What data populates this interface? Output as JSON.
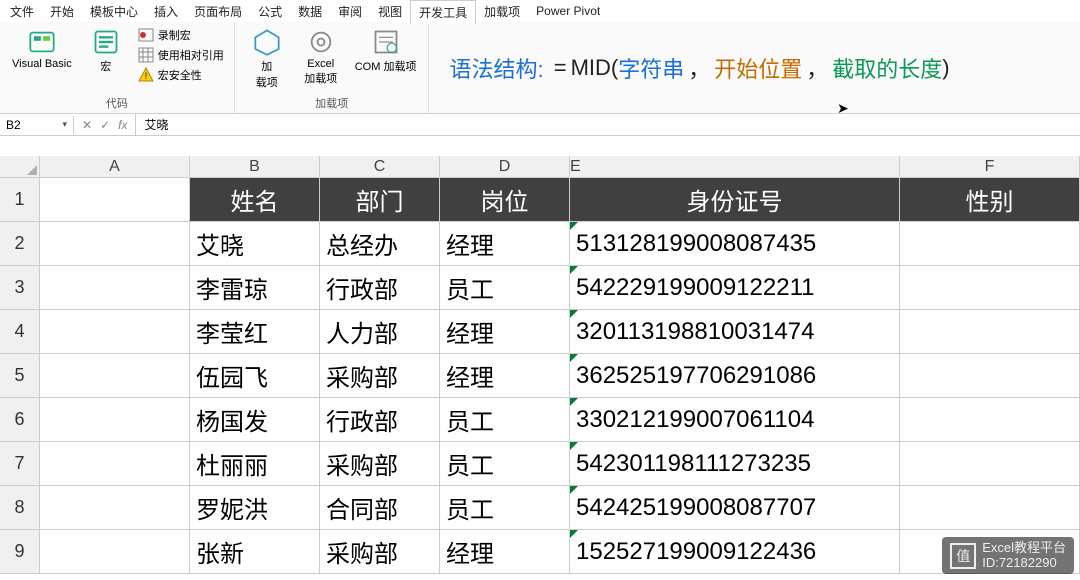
{
  "menu": {
    "items": [
      "文件",
      "开始",
      "模板中心",
      "插入",
      "页面布局",
      "公式",
      "数据",
      "审阅",
      "视图",
      "开发工具",
      "加载项",
      "Power Pivot"
    ],
    "active_index": 9
  },
  "ribbon": {
    "group1": {
      "label": "代码",
      "vb": "Visual Basic",
      "macro": "宏",
      "record": "录制宏",
      "relative": "使用相对引用",
      "security": "宏安全性"
    },
    "group2": {
      "label": "加载项",
      "addins": "加\n载项",
      "excel_addins": "Excel\n加载项",
      "com_addins": "COM 加载项"
    }
  },
  "formula_hint": {
    "label": "语法结构:",
    "equals": "=",
    "func": "MID(",
    "p1": "字符串",
    "sep": "，",
    "p2": "开始位置",
    "p3": "截取的长度",
    "close": ")"
  },
  "fbar": {
    "name_box": "B2",
    "value": "艾晓"
  },
  "columns": [
    "A",
    "B",
    "C",
    "D",
    "E",
    "F"
  ],
  "col_widths": {
    "A": 150,
    "B": 130,
    "C": 120,
    "D": 130,
    "E": 330,
    "F": 180
  },
  "headers": {
    "B": "姓名",
    "C": "部门",
    "D": "岗位",
    "E": "身份证号",
    "F": "性别"
  },
  "rows": [
    {
      "n": 1,
      "is_header": true
    },
    {
      "n": 2,
      "B": "艾晓",
      "C": "总经办",
      "D": "经理",
      "E": "513128199008087435"
    },
    {
      "n": 3,
      "B": "李雷琼",
      "C": "行政部",
      "D": "员工",
      "E": "542229199009122211"
    },
    {
      "n": 4,
      "B": "李莹红",
      "C": "人力部",
      "D": "经理",
      "E": "320113198810031474"
    },
    {
      "n": 5,
      "B": "伍园飞",
      "C": "采购部",
      "D": "经理",
      "E": "362525197706291086"
    },
    {
      "n": 6,
      "B": "杨国发",
      "C": "行政部",
      "D": "员工",
      "E": "330212199007061104"
    },
    {
      "n": 7,
      "B": "杜丽丽",
      "C": "采购部",
      "D": "员工",
      "E": "542301198111273235"
    },
    {
      "n": 8,
      "B": "罗妮洪",
      "C": "合同部",
      "D": "员工",
      "E": "542425199008087707"
    },
    {
      "n": 9,
      "B": "张新",
      "C": "采购部",
      "D": "经理",
      "E": "152527199009122436"
    }
  ],
  "watermark": {
    "brand": "Excel教程平台",
    "id_label": "ID:",
    "id": "72182290",
    "logo_glyph": "值"
  }
}
